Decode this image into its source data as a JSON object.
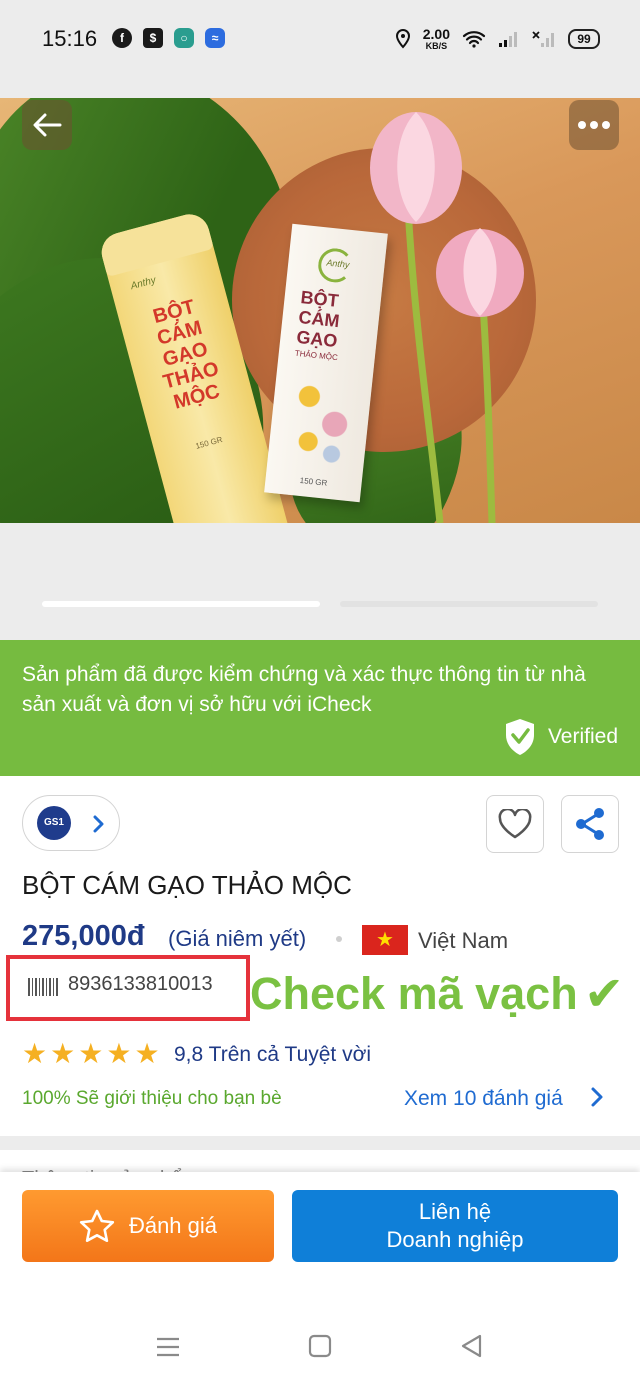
{
  "status_bar": {
    "time": "15:16",
    "notification_icons": [
      "facebook-icon",
      "mobile-banking-icon",
      "chat-icon",
      "wifi-transfer-icon"
    ],
    "net_speed_value": "2.00",
    "net_speed_unit": "KB/S",
    "battery": "99"
  },
  "hero": {
    "icons": {
      "back": "back-arrow-icon",
      "more": "more-dots-icon"
    },
    "carousel_pages": 2,
    "active_page": 1,
    "logo_text": "Anthy",
    "bottle_lines": [
      "BỘT",
      "CÁM",
      "GẠO",
      "THẢO",
      "MỘC"
    ],
    "bottle_weight": "150 GR",
    "box_lines": [
      "BỘT",
      "CÁM",
      "GẠO"
    ],
    "box_subline": "THẢO MỘC",
    "box_weight": "150 GR"
  },
  "verified_banner": {
    "message": "Sản phẩm đã được kiểm chứng và xác thực thông tin từ nhà sản xuất và đơn vị sở hữu với iCheck",
    "badge_label": "Verified",
    "color": "#76bb40"
  },
  "product": {
    "gs1_label": "GS1",
    "title": "BỘT CÁM GẠO THẢO MỘC",
    "price": "275,000đ",
    "price_note": "(Giá niêm yết)",
    "country": "Việt Nam",
    "barcode": "8936133810013",
    "check_overlay": "Check mã vạch",
    "check_mark": "✔",
    "stars": 5,
    "rating_text": "9,8 Trên cả Tuyệt vời",
    "recommend_text": "100% Sẽ giới thiệu cho bạn bè",
    "reviews_link": "Xem 10 đánh giá",
    "section_peek": "Thông tin sản phẩm"
  },
  "actions": {
    "rate_label": "Đánh giá",
    "contact_line1": "Liên hệ",
    "contact_line2": "Doanh nghiệp",
    "rate_color": "#f37619",
    "contact_color": "#0f7fd8"
  },
  "nav_bar": {
    "icons": [
      "recent-apps-icon",
      "home-icon",
      "back-icon"
    ]
  }
}
